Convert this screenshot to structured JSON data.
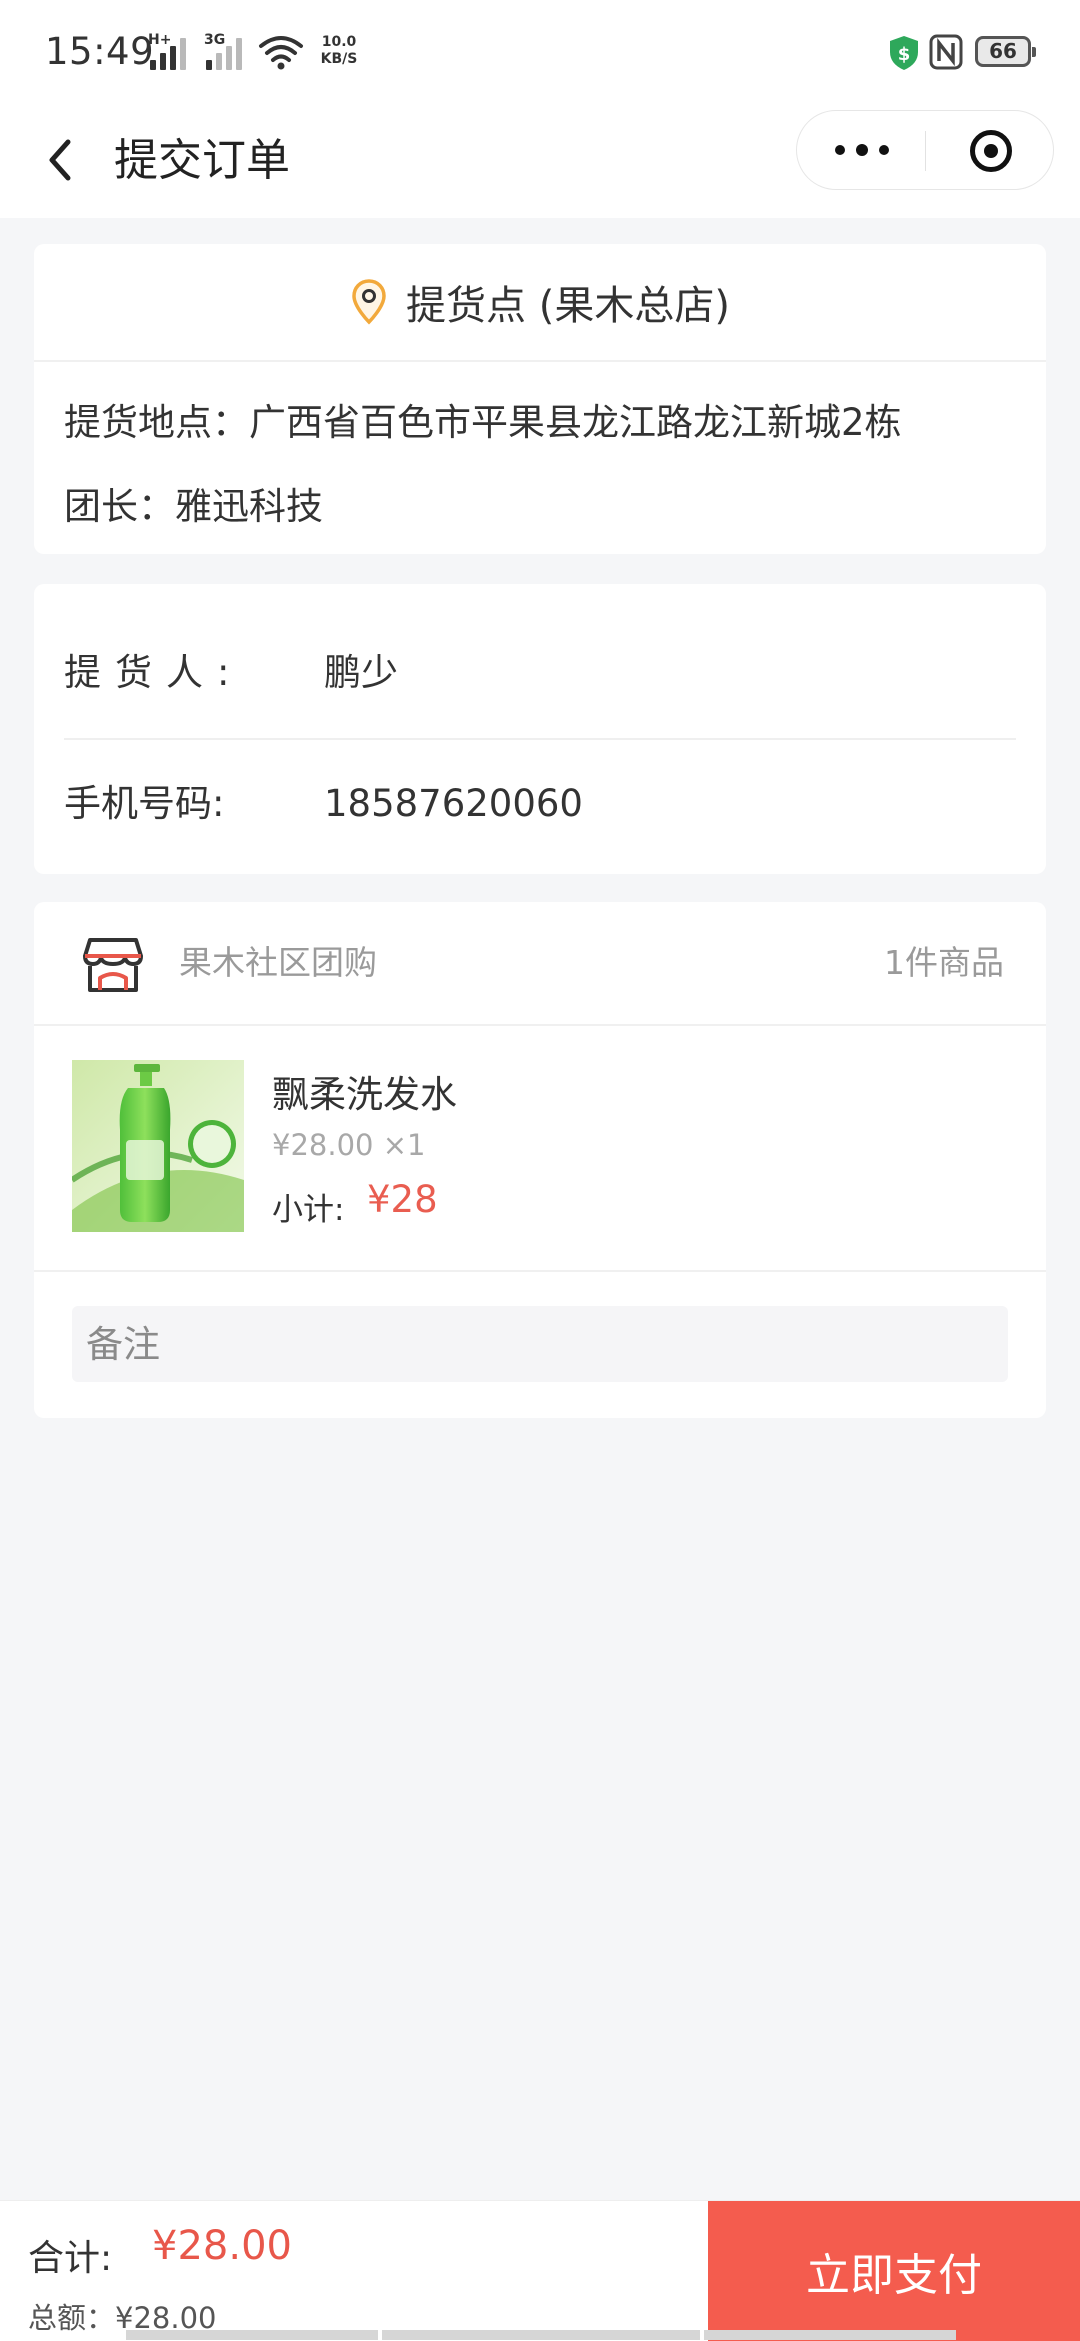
{
  "status_bar": {
    "time": "15:49",
    "signal1_tag": "H+",
    "signal2_tag": "3G",
    "net_speed_value": "10.0",
    "net_speed_unit": "KB/S",
    "battery": "66",
    "icons": [
      "signal-icon",
      "wifi-icon",
      "shield-icon",
      "nfc-icon",
      "battery-icon"
    ]
  },
  "nav": {
    "title": "提交订单",
    "back_icon": "chevron-left-icon",
    "more_icon": "more-dots-icon",
    "close_icon": "target-icon"
  },
  "pickup": {
    "title": "提货点 (果木总店)",
    "address": "提货地点：广西省百色市平果县龙江路龙江新城2栋",
    "leader": "团长：雅迅科技"
  },
  "contact": {
    "name_label": "提货人:",
    "name_value": "鹏少",
    "phone_label": "手机号码:",
    "phone_value": "18587620060"
  },
  "shop": {
    "name": "果木社区团购",
    "count": "1件商品",
    "icon": "store-icon"
  },
  "goods": [
    {
      "name": "飘柔洗发水",
      "price_qty": "¥28.00 ×1",
      "subtotal_label": "小计:",
      "subtotal_value": "¥28"
    }
  ],
  "remark": {
    "placeholder": "备注"
  },
  "footer": {
    "total_label": "合计:",
    "total_value": "¥28.00",
    "sum_line": "总额：¥28.00",
    "pay_label": "立即支付"
  },
  "colors": {
    "accent": "#f45c4e",
    "price": "#e8574a",
    "pin": "#f2a93b",
    "background": "#f5f6f8"
  }
}
